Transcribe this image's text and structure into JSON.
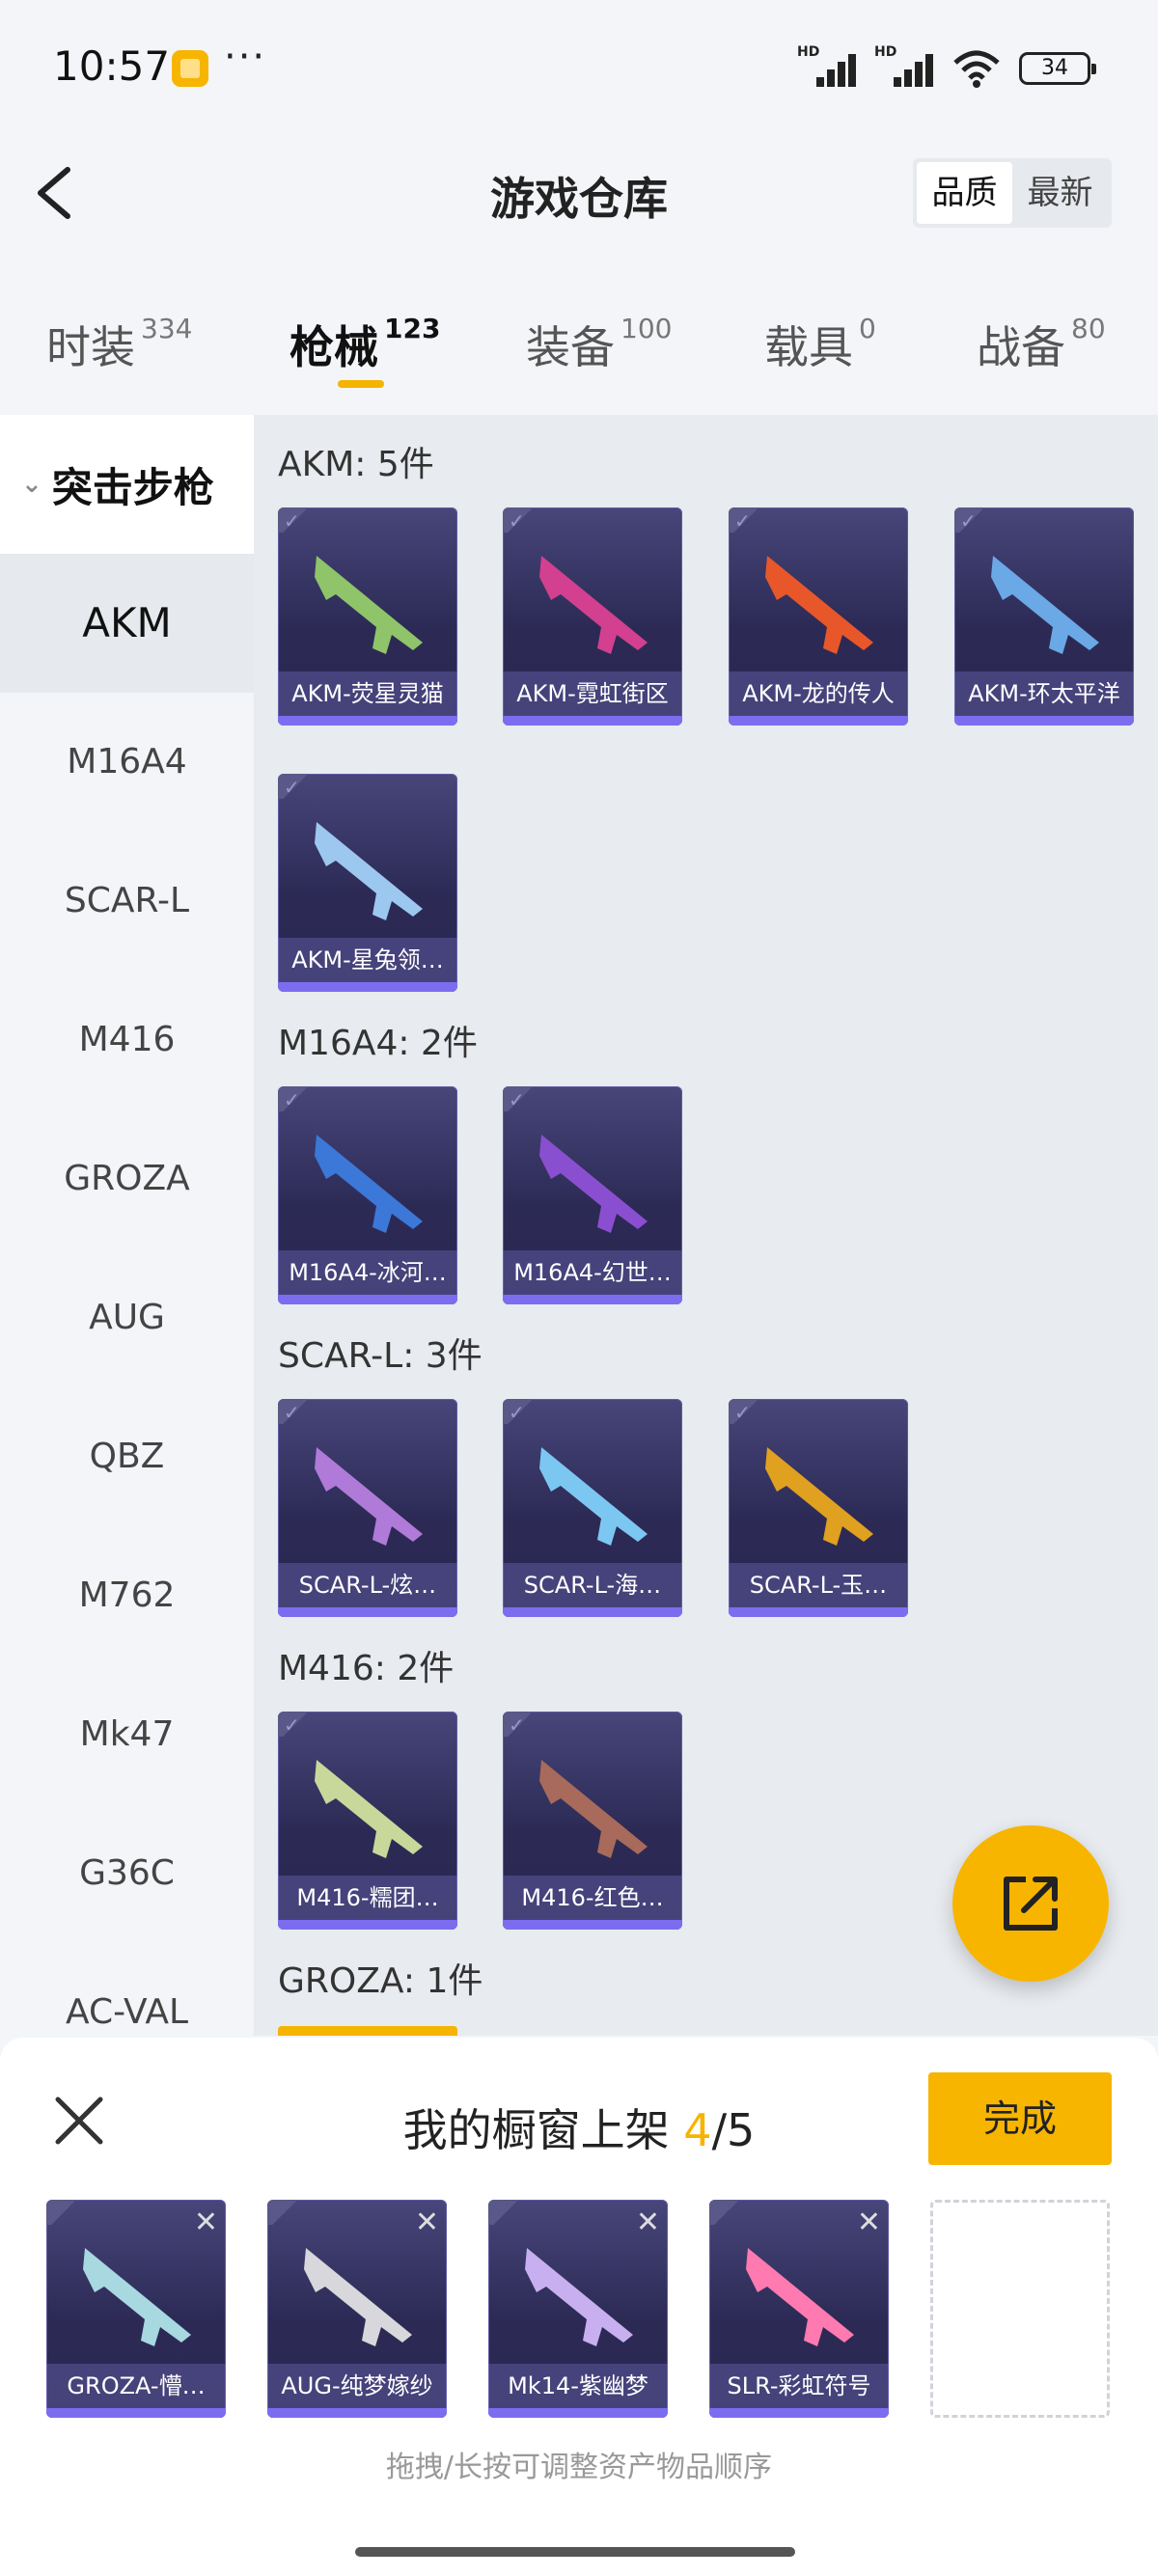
{
  "status_bar": {
    "time": "10:57",
    "battery": "34",
    "more": "···"
  },
  "header": {
    "title": "游戏仓库",
    "sort_options": [
      "品质",
      "最新"
    ],
    "sort_active": "品质"
  },
  "tabs": [
    {
      "name": "时装",
      "count": "334"
    },
    {
      "name": "枪械",
      "count": "123",
      "active": true
    },
    {
      "name": "装备",
      "count": "100"
    },
    {
      "name": "载具",
      "count": "0"
    },
    {
      "name": "战备",
      "count": "80"
    }
  ],
  "sidebar": {
    "group": "突击步枪",
    "items": [
      "AKM",
      "M16A4",
      "SCAR-L",
      "M416",
      "GROZA",
      "AUG",
      "QBZ",
      "M762",
      "Mk47",
      "G36C",
      "AC-VAL"
    ],
    "active": "AKM"
  },
  "sections": [
    {
      "title": "AKM: 5件",
      "items": [
        "AKM-荧星灵猫",
        "AKM-霓虹街区",
        "AKM-龙的传人",
        "AKM-环太平洋",
        "AKM-星兔领…"
      ]
    },
    {
      "title": "M16A4: 2件",
      "items": [
        "M16A4-冰河…",
        "M16A4-幻世…"
      ]
    },
    {
      "title": "SCAR-L: 3件",
      "items": [
        "SCAR-L-炫…",
        "SCAR-L-海…",
        "SCAR-L-玉…"
      ]
    },
    {
      "title": "M416: 2件",
      "items": [
        "M416-糯团…",
        "M416-红色…"
      ]
    },
    {
      "title": "GROZA: 1件",
      "items": []
    }
  ],
  "sheet": {
    "title_prefix": "我的橱窗上架",
    "current": "4",
    "total": "/5",
    "done_label": "完成",
    "slots": [
      "GROZA-懵…",
      "AUG-纯梦嫁纱",
      "Mk14-紫幽梦",
      "SLR-彩虹符号"
    ],
    "hint": "拖拽/长按可调整资产物品顺序"
  },
  "colors": {
    "accent": "#f7b500",
    "card_top": "#48467a",
    "card_bottom": "#2a2850",
    "card_bar": "#7c6df0"
  },
  "icons": [
    "back-icon",
    "check-icon",
    "export-icon",
    "close-icon",
    "remove-icon",
    "chevron-down-icon"
  ]
}
